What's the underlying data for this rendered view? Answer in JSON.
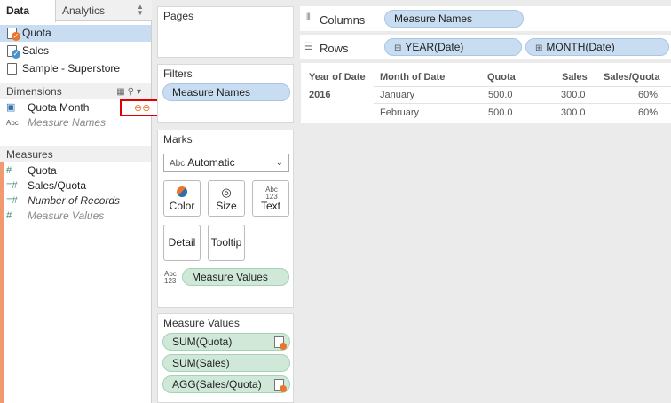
{
  "tabs": {
    "data": "Data",
    "analytics": "Analytics"
  },
  "datasources": [
    {
      "name": "Quota"
    },
    {
      "name": "Sales"
    },
    {
      "name": "Sample - Superstore"
    }
  ],
  "dimensions": {
    "header": "Dimensions",
    "fields": [
      {
        "name": "Quota Month",
        "icon": "calendar-icon"
      },
      {
        "name": "Measure Names",
        "icon": "abc-icon"
      }
    ]
  },
  "measures": {
    "header": "Measures",
    "fields": [
      {
        "name": "Quota"
      },
      {
        "name": "Sales/Quota"
      },
      {
        "name": "Number of Records"
      },
      {
        "name": "Measure Values"
      }
    ]
  },
  "cards": {
    "pages": "Pages",
    "filters": "Filters",
    "filter_pill": "Measure Names",
    "marks": "Marks",
    "mark_type": "Automatic",
    "mark_type_icon": "Abc",
    "mark_buttons": {
      "color": "Color",
      "size": "Size",
      "text": "Text",
      "detail": "Detail",
      "tooltip": "Tooltip"
    },
    "text_icon": "Abc 123",
    "marks_pill": "Measure Values",
    "measure_values_title": "Measure Values",
    "measure_values_pills": [
      "SUM(Quota)",
      "SUM(Sales)",
      "AGG(Sales/Quota)"
    ]
  },
  "shelves": {
    "columns_label": "Columns",
    "columns_pill": "Measure Names",
    "rows_label": "Rows",
    "rows_pills": [
      "YEAR(Date)",
      "MONTH(Date)"
    ]
  },
  "table": {
    "headers": [
      "Year of Date",
      "Month of Date",
      "Quota",
      "Sales",
      "Sales/Quota"
    ],
    "year": "2016",
    "rows": [
      {
        "month": "January",
        "quota": "500.0",
        "sales": "300.0",
        "ratio": "60%"
      },
      {
        "month": "February",
        "quota": "500.0",
        "sales": "300.0",
        "ratio": "60%"
      }
    ]
  },
  "colors": {
    "accent_orange": "#e8762d",
    "pill_blue": "#c8ddf2",
    "pill_green": "#cfe8d8",
    "highlight_red": "#e00000"
  }
}
